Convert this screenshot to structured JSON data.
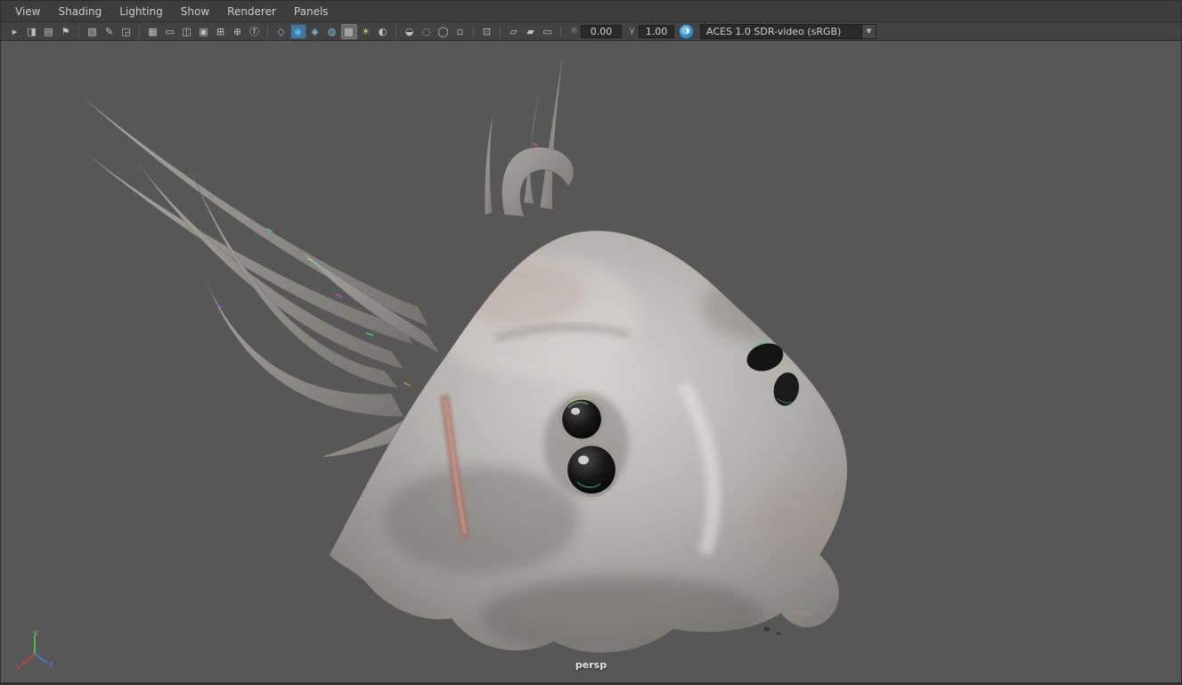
{
  "menubar": {
    "items": [
      {
        "name": "menu-view",
        "label": "View"
      },
      {
        "name": "menu-shading",
        "label": "Shading"
      },
      {
        "name": "menu-lighting",
        "label": "Lighting"
      },
      {
        "name": "menu-show",
        "label": "Show"
      },
      {
        "name": "menu-renderer",
        "label": "Renderer"
      },
      {
        "name": "menu-panels",
        "label": "Panels"
      }
    ]
  },
  "toolbar": {
    "group_camera": [
      {
        "name": "select-camera-icon",
        "glyph": "▸"
      },
      {
        "name": "lock-camera-icon",
        "glyph": "◨"
      },
      {
        "name": "camera-attributes-icon",
        "glyph": "▤"
      },
      {
        "name": "bookmark-icon",
        "glyph": "⚑"
      }
    ],
    "group_image": [
      {
        "name": "image-plane-icon",
        "glyph": "▧"
      },
      {
        "name": "grease-pencil-icon",
        "glyph": "✎"
      },
      {
        "name": "pan-zoom-icon",
        "glyph": "◲"
      }
    ],
    "group_gates": [
      {
        "name": "grid-icon",
        "glyph": "▦"
      },
      {
        "name": "film-gate-icon",
        "glyph": "▭"
      },
      {
        "name": "resolution-gate-icon",
        "glyph": "◫"
      },
      {
        "name": "gate-mask-icon",
        "glyph": "▣"
      },
      {
        "name": "field-chart-icon",
        "glyph": "⊞"
      },
      {
        "name": "safe-action-icon",
        "glyph": "⊕"
      },
      {
        "name": "safe-title-icon",
        "glyph": "Ⓣ"
      }
    ],
    "group_shading": [
      {
        "name": "wireframe-icon",
        "glyph": "◇",
        "color": "#8fb8cc"
      },
      {
        "name": "smooth-shade-icon",
        "glyph": "◆",
        "color": "#45b8e8",
        "active": "blue"
      },
      {
        "name": "flat-shade-icon",
        "glyph": "◈",
        "color": "#79c0d8"
      },
      {
        "name": "textured-icon",
        "glyph": "◍",
        "color": "#79c0d8"
      },
      {
        "name": "use-default-material-icon",
        "glyph": "▩",
        "active": "soft"
      },
      {
        "name": "lights-icon",
        "glyph": "☀",
        "color": "#d6c87e"
      },
      {
        "name": "shadows-icon",
        "glyph": "◐"
      }
    ],
    "group_render_fx": [
      {
        "name": "occlusion-icon",
        "glyph": "◒"
      },
      {
        "name": "motion-blur-icon",
        "glyph": "◌"
      },
      {
        "name": "depth-of-field-icon",
        "glyph": "◯"
      },
      {
        "name": "anti-alias-icon",
        "glyph": "▫"
      }
    ],
    "group_isolate": [
      {
        "name": "isolate-select-icon",
        "glyph": "⊡"
      }
    ],
    "group_xray": [
      {
        "name": "xray-icon",
        "glyph": "▱"
      },
      {
        "name": "xray-joints-icon",
        "glyph": "▰"
      },
      {
        "name": "plate-icon",
        "glyph": "▭"
      }
    ],
    "exposure": {
      "icon_glyph": "☼",
      "value": "0.00"
    },
    "gamma": {
      "icon_glyph": "γ",
      "value": "1.00"
    },
    "color_management_glyph": "◑",
    "view_transform": {
      "value": "ACES 1.0 SDR-video (sRGB)"
    },
    "dropdown_arrow_glyph": "▼"
  },
  "viewport": {
    "camera_label": "persp",
    "axis_labels": {
      "x": "x",
      "y": "y",
      "z": "z"
    },
    "colors": {
      "background": "#575757",
      "x_axis": "#e03a3a",
      "y_axis": "#4ad24a",
      "z_axis": "#4a7de0",
      "accent_blue": "#4aa3df"
    }
  }
}
